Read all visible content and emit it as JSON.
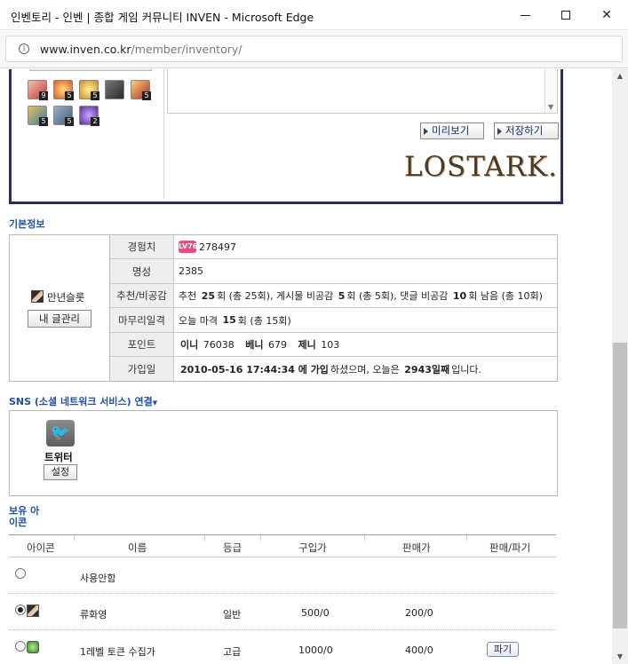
{
  "window": {
    "title": "인벤토리 - 인벤 | 종합 게임 커뮤니티 INVEN - Microsoft Edge"
  },
  "address": {
    "domain": "www.inven.co.kr",
    "path": "/member/inventory/"
  },
  "top_panel": {
    "items": [
      {
        "icon": "red-potion-icon",
        "count": "9"
      },
      {
        "icon": "orange-orb-icon",
        "count": "5"
      },
      {
        "icon": "gold-orb-icon",
        "count": "5"
      },
      {
        "icon": "hammer-icon",
        "count": ""
      },
      {
        "icon": "red-gem-icon",
        "count": "5"
      },
      {
        "icon": "blue-sword-icon",
        "count": "5"
      },
      {
        "icon": "shield-icon",
        "count": "5"
      },
      {
        "icon": "purple-orb-icon",
        "count": "2"
      }
    ],
    "preview_label": "미리보기",
    "save_label": "저장하기",
    "logo_text": "LOSTARK."
  },
  "basic_info": {
    "section_title": "기본정보",
    "nickname": "만년슬롯",
    "manage_label": "내 글관리",
    "rows": {
      "exp": {
        "label": "경험치",
        "level": "76",
        "value": "278497"
      },
      "fame": {
        "label": "명성",
        "value": "2385"
      },
      "recommend": {
        "label": "추천/비공감",
        "prefix": "추천",
        "rec_count": "25",
        "rec_rest": "회 (총 25회), 게시물 비공감",
        "dislike_count": "5",
        "dislike_rest": "회 (총 5회), 댓글 비공감",
        "comment_count": "10",
        "comment_rest": "회 남음 (총 10회)"
      },
      "finish": {
        "label": "마무리일격",
        "prefix": "오늘 마격",
        "count": "15",
        "rest": "회 (총 15회)"
      },
      "point": {
        "label": "포인트",
        "inny_label": "이니",
        "inny_value": "76038",
        "beny_label": "베니",
        "beny_value": "679",
        "jeny_label": "제니",
        "jeny_value": "103"
      },
      "joined": {
        "label": "가입일",
        "date": "2010-05-16 17:44:34 에 가입",
        "mid": "하셨으며, 오늘은",
        "days": "2943일째",
        "end": "입니다."
      }
    }
  },
  "sns": {
    "section_title": "SNS (소셜 네트워크 서비스) 연결",
    "twitter_label": "트위터",
    "setting_label": "설정"
  },
  "icons": {
    "section_title_1": "보유 아",
    "section_title_2": "이콘",
    "headers": [
      "아이콘",
      "이름",
      "등급",
      "구입가",
      "판매가",
      "판매/파기"
    ],
    "rows": [
      {
        "name": "사용안함",
        "grade": "",
        "buy": "",
        "sell": "",
        "action": "",
        "selected": false,
        "has_icon": false
      },
      {
        "name": "류화영",
        "grade": "일반",
        "buy": "500/0",
        "sell": "200/0",
        "action": "",
        "selected": true,
        "has_icon": true
      },
      {
        "name": "1레벨 토큰 수집가",
        "grade": "고급",
        "buy": "1000/0",
        "sell": "400/0",
        "action": "파기",
        "selected": false,
        "has_icon": true
      }
    ]
  },
  "colors": {
    "frame_navy": "#2b2d6b",
    "section_blue": "#1f52a0",
    "level_pink": "#e94b87"
  }
}
